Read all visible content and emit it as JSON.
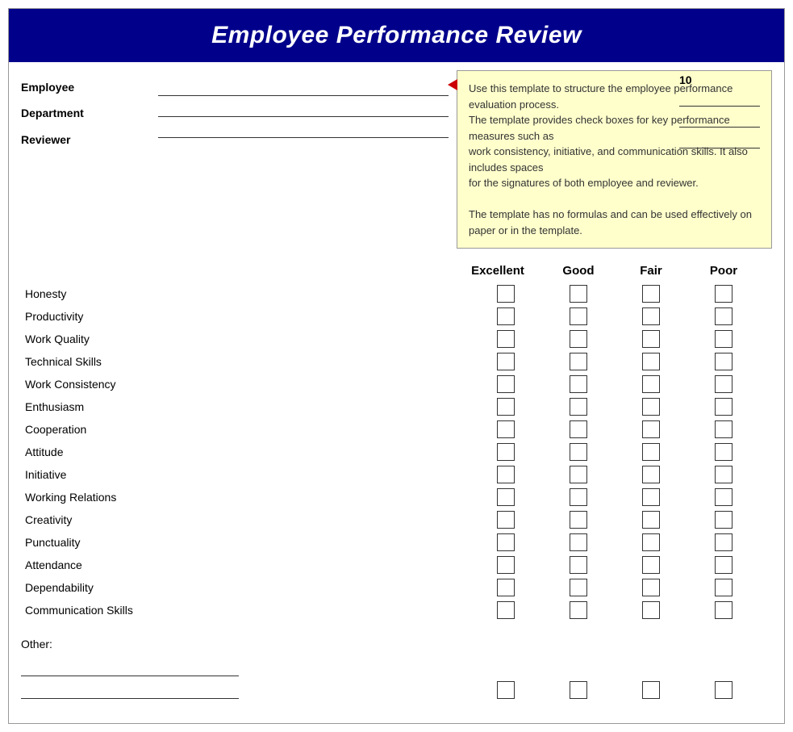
{
  "header": {
    "title": "Employee Performance Review"
  },
  "tooltip": {
    "text1": "Use this template to structure the employee performance evaluation process.",
    "text2": "The template provides check boxes for key performance measures such as",
    "text3": "work consistency, initiative, and communication skills. It also includes spaces",
    "text4": "for the signatures of both employee and reviewer.",
    "text5": "",
    "text6": "The template has no formulas and can be used effectively on paper or in the template."
  },
  "employeeInfo": {
    "employee_label": "Employee",
    "department_label": "Department",
    "reviewer_label": "Reviewer"
  },
  "scoreLabel": "10",
  "ratingHeaders": {
    "excellent": "Excellent",
    "good": "Good",
    "fair": "Fair",
    "poor": "Poor"
  },
  "criteria": [
    {
      "label": "Honesty"
    },
    {
      "label": "Productivity"
    },
    {
      "label": "Work Quality"
    },
    {
      "label": "Technical Skills"
    },
    {
      "label": "Work Consistency"
    },
    {
      "label": "Enthusiasm"
    },
    {
      "label": "Cooperation"
    },
    {
      "label": "Attitude"
    },
    {
      "label": "Initiative"
    },
    {
      "label": "Working Relations"
    },
    {
      "label": "Creativity"
    },
    {
      "label": "Punctuality"
    },
    {
      "label": "Attendance"
    },
    {
      "label": "Dependability"
    },
    {
      "label": "Communication Skills"
    }
  ],
  "other": {
    "label": "Other:"
  }
}
